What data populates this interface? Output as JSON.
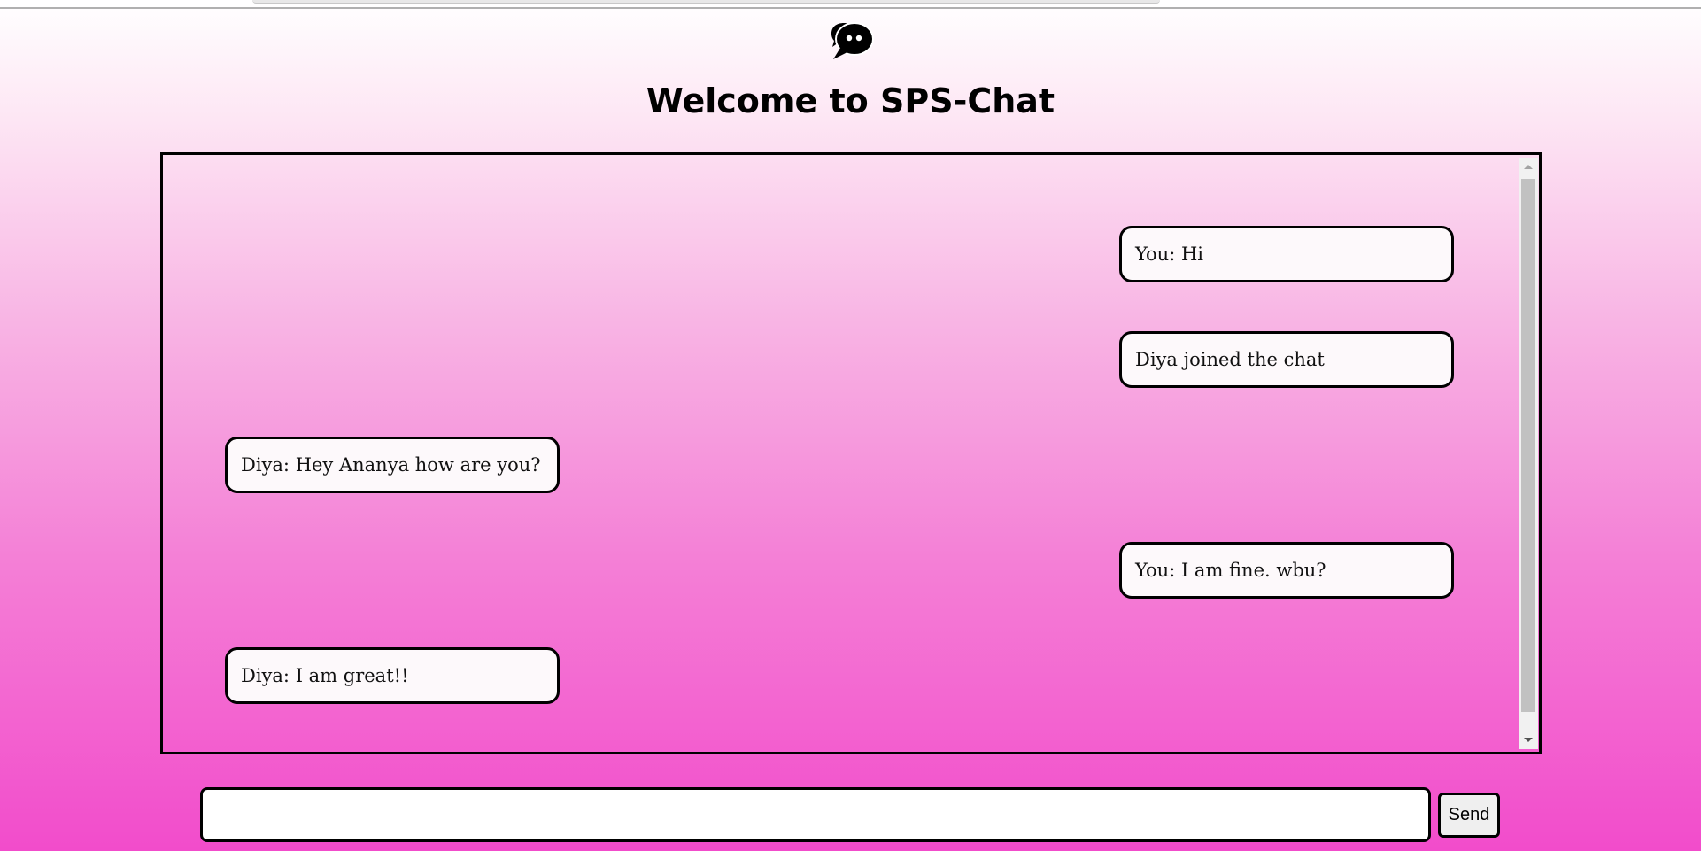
{
  "header": {
    "logo_icon": "chat-bubbles-icon",
    "title": "Welcome to SPS-Chat"
  },
  "chat": {
    "messages": [
      {
        "text": "You: Hi",
        "side": "right"
      },
      {
        "text": "Diya joined the chat",
        "side": "right"
      },
      {
        "text": "Diya: Hey Ananya how are you?",
        "side": "left"
      },
      {
        "text": "You: I am fine. wbu?",
        "side": "right"
      },
      {
        "text": "Diya: I am great!!",
        "side": "left"
      }
    ]
  },
  "composer": {
    "input_value": "",
    "send_label": "Send"
  },
  "colors": {
    "gradient_top": "#ffffff",
    "gradient_bottom": "#f24ccb",
    "bubble_background": "#fdf9fb",
    "border": "#000000"
  }
}
